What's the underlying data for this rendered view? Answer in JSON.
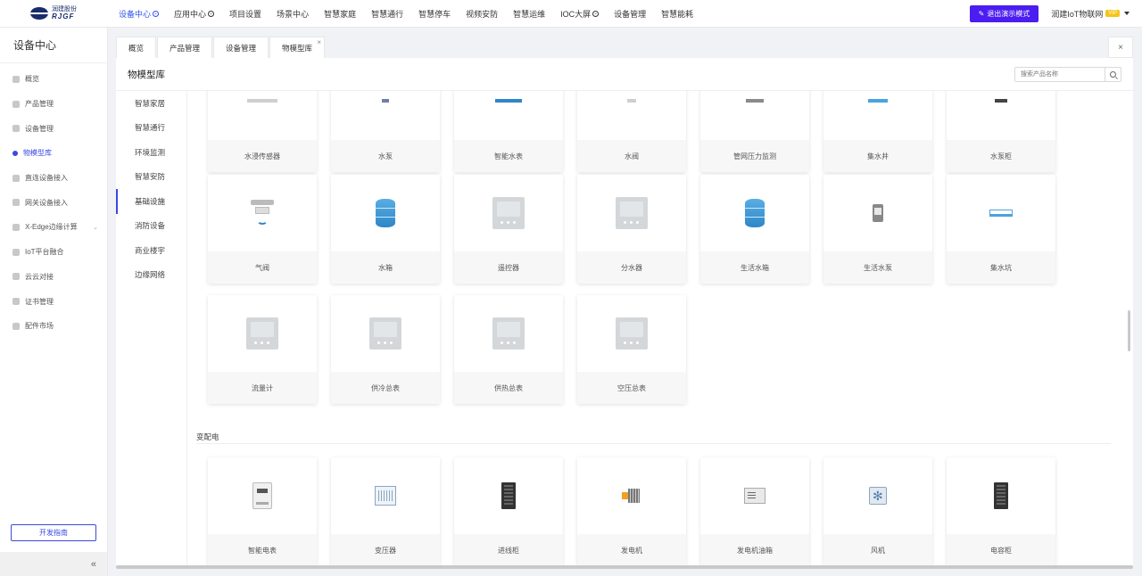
{
  "logo": {
    "cn": "润建股份",
    "en": "RJGF"
  },
  "nav": [
    {
      "label": "设备中心",
      "active": true,
      "caret": true
    },
    {
      "label": "应用中心",
      "active": false,
      "caret": true
    },
    {
      "label": "项目设置",
      "active": false,
      "caret": false
    },
    {
      "label": "场景中心",
      "active": false,
      "caret": false
    },
    {
      "label": "智慧家庭",
      "active": false,
      "caret": false
    },
    {
      "label": "智慧通行",
      "active": false,
      "caret": false
    },
    {
      "label": "智慧停车",
      "active": false,
      "caret": false
    },
    {
      "label": "视频安防",
      "active": false,
      "caret": false
    },
    {
      "label": "智慧运维",
      "active": false,
      "caret": false
    },
    {
      "label": "IOC大屏",
      "active": false,
      "caret": true
    },
    {
      "label": "设备管理",
      "active": false,
      "caret": false
    },
    {
      "label": "智慧能耗",
      "active": false,
      "caret": false
    }
  ],
  "topright": {
    "demo_button": "退出演示模式",
    "user": "润建IoT物联网",
    "vip": "VIP"
  },
  "sidebar": {
    "title": "设备中心",
    "items": [
      {
        "label": "概览",
        "active": false,
        "chevron": false
      },
      {
        "label": "产品管理",
        "active": false,
        "chevron": false
      },
      {
        "label": "设备管理",
        "active": false,
        "chevron": false
      },
      {
        "label": "物模型库",
        "active": true,
        "chevron": false
      },
      {
        "label": "直连设备接入",
        "active": false,
        "chevron": false
      },
      {
        "label": "网关设备接入",
        "active": false,
        "chevron": false
      },
      {
        "label": "X-Edge边缘计算",
        "active": false,
        "chevron": true
      },
      {
        "label": "IoT平台融合",
        "active": false,
        "chevron": false
      },
      {
        "label": "云云对接",
        "active": false,
        "chevron": false
      },
      {
        "label": "证书管理",
        "active": false,
        "chevron": false
      },
      {
        "label": "配件市场",
        "active": false,
        "chevron": false
      }
    ],
    "dev_guide": "开发指南",
    "collapse": "«"
  },
  "tabs": [
    {
      "label": "概览",
      "closable": false
    },
    {
      "label": "产品管理",
      "closable": false
    },
    {
      "label": "设备管理",
      "closable": false
    },
    {
      "label": "物模型库",
      "closable": true
    }
  ],
  "tabbar_close": "×",
  "panel": {
    "title": "物模型库",
    "search_placeholder": "搜索产品名称"
  },
  "categories": [
    {
      "label": "智慧家居",
      "active": false
    },
    {
      "label": "智慧通行",
      "active": false
    },
    {
      "label": "环境监测",
      "active": false
    },
    {
      "label": "智慧安防",
      "active": false
    },
    {
      "label": "基础设施",
      "active": true
    },
    {
      "label": "消防设备",
      "active": false
    },
    {
      "label": "商业楼宇",
      "active": false
    },
    {
      "label": "边缘网络",
      "active": false
    }
  ],
  "row_top": [
    {
      "label": "水浸传感器",
      "icon": "water-leak-sensor-icon"
    },
    {
      "label": "水泵",
      "icon": "pump-icon"
    },
    {
      "label": "智能水表",
      "icon": "smart-water-meter-icon"
    },
    {
      "label": "水阀",
      "icon": "water-valve-icon"
    },
    {
      "label": "管网压力监测",
      "icon": "pressure-monitor-icon"
    },
    {
      "label": "集水井",
      "icon": "sump-well-icon"
    },
    {
      "label": "水泵柜",
      "icon": "pump-cabinet-icon"
    }
  ],
  "row_mid": [
    {
      "label": "气阀",
      "icon": "gas-valve-icon",
      "kind": "valve"
    },
    {
      "label": "水箱",
      "icon": "water-tank-icon",
      "kind": "tank"
    },
    {
      "label": "遥控器",
      "icon": "remote-control-icon",
      "kind": "panel"
    },
    {
      "label": "分水器",
      "icon": "water-distributor-icon",
      "kind": "panel"
    },
    {
      "label": "生活水箱",
      "icon": "domestic-water-tank-icon",
      "kind": "tank"
    },
    {
      "label": "生活水泵",
      "icon": "domestic-pump-icon",
      "kind": "pump"
    },
    {
      "label": "集水坑",
      "icon": "sump-pit-icon",
      "kind": "pit"
    }
  ],
  "row_low": [
    {
      "label": "流量计",
      "icon": "flow-meter-icon",
      "kind": "panel"
    },
    {
      "label": "供冷总表",
      "icon": "cooling-meter-icon",
      "kind": "panel"
    },
    {
      "label": "供热总表",
      "icon": "heating-meter-icon",
      "kind": "panel"
    },
    {
      "label": "空压总表",
      "icon": "air-compressor-meter-icon",
      "kind": "panel"
    }
  ],
  "section2_title": "变配电",
  "row_power": [
    {
      "label": "智能电表",
      "icon": "smart-electric-meter-icon",
      "kind": "meter"
    },
    {
      "label": "变压器",
      "icon": "transformer-icon",
      "kind": "trans"
    },
    {
      "label": "进线柜",
      "icon": "incoming-cabinet-icon",
      "kind": "cab"
    },
    {
      "label": "发电机",
      "icon": "generator-icon",
      "kind": "gen"
    },
    {
      "label": "发电机油箱",
      "icon": "generator-fuel-tank-icon",
      "kind": "genbox"
    },
    {
      "label": "风机",
      "icon": "fan-icon",
      "kind": "fan"
    },
    {
      "label": "电容柜",
      "icon": "capacitor-cabinet-icon",
      "kind": "cab"
    }
  ]
}
